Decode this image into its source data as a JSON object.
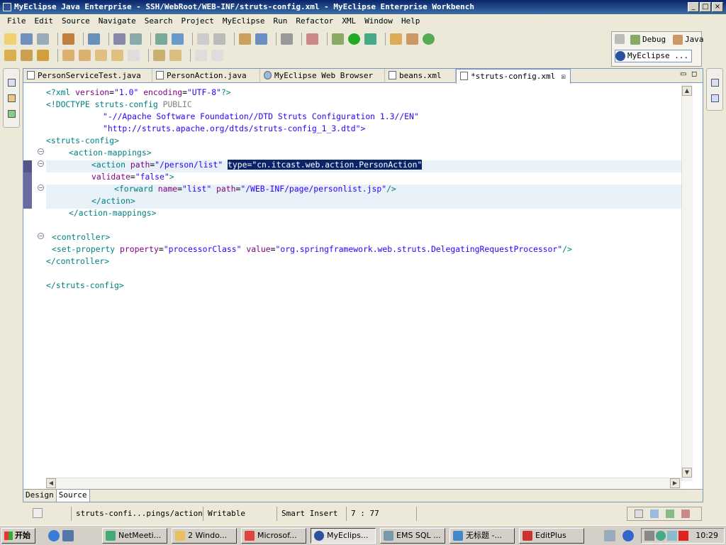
{
  "window": {
    "title": "MyEclipse Java Enterprise - SSH/WebRoot/WEB-INF/struts-config.xml - MyEclipse Enterprise Workbench"
  },
  "menu": [
    "File",
    "Edit",
    "Source",
    "Navigate",
    "Search",
    "Project",
    "MyEclipse",
    "Run",
    "Refactor",
    "XML",
    "Window",
    "Help"
  ],
  "perspectives": {
    "debug": "Debug",
    "java": "Java",
    "myeclipse": "MyEclipse ..."
  },
  "tabs": [
    {
      "label": "PersonServiceTest.java"
    },
    {
      "label": "PersonAction.java"
    },
    {
      "label": "MyEclipse Web Browser"
    },
    {
      "label": "beans.xml"
    },
    {
      "label": "*struts-config.xml"
    }
  ],
  "code": {
    "l1": {
      "a": "<?xml ",
      "b": "version",
      "c": "=",
      "d": "\"1.0\"",
      "e": " ",
      "f": "encoding",
      "g": "=",
      "h": "\"UTF-8\"",
      "i": "?>"
    },
    "l2": {
      "a": "<!DOCTYPE struts-config ",
      "b": "PUBLIC"
    },
    "l3": "\"-//Apache Software Foundation//DTD Struts Configuration 1.3//EN\"",
    "l4": "\"http://struts.apache.org/dtds/struts-config_1_3.dtd\">",
    "l5": "<struts-config>",
    "l6": "<action-mappings>",
    "l7": {
      "a": "<action ",
      "b": "path",
      "c": "=",
      "d": "\"/person/list\"",
      "sel": "type=\"cn.itcast.web.action.PersonAction\""
    },
    "l8": {
      "b": "validate",
      "c": "=",
      "d": "\"false\"",
      "e": ">"
    },
    "l9": {
      "a": "<forward ",
      "b": "name",
      "c": "=",
      "d": "\"list\"",
      "e": " ",
      "f": "path",
      "g": "=",
      "h": "\"/WEB-INF/page/personlist.jsp\"",
      "i": "/>"
    },
    "l10": "</action>",
    "l11": "</action-mappings>",
    "l13": "<controller>",
    "l14": {
      "a": "<set-property ",
      "b": "property",
      "c": "=",
      "d": "\"processorClass\"",
      "e": " ",
      "f": "value",
      "g": "=",
      "h": "\"org.springframework.web.struts.DelegatingRequestProcessor\"",
      "i": "/>"
    },
    "l15": "</controller>",
    "l17": "</struts-config>"
  },
  "bottom_tabs": {
    "design": "Design",
    "source": "Source"
  },
  "status": {
    "path": "struts-confi...pings/action",
    "mode": "Writable",
    "insert": "Smart Insert",
    "position": "7 : 77"
  },
  "taskbar": {
    "start": "开始",
    "items": [
      "NetMeeti...",
      "2 Windo...",
      "Microsof...",
      "MyEclips...",
      "EMS SQL ...",
      "无标题 -...",
      "EditPlus"
    ],
    "clock": "10:29"
  }
}
